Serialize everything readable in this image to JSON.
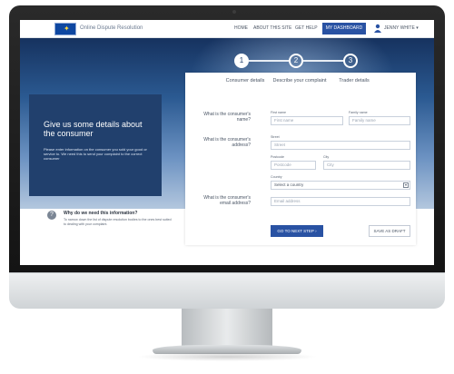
{
  "header": {
    "site_name": "Online Dispute Resolution",
    "nav": [
      "HOME",
      "ABOUT THIS SITE",
      "GET HELP"
    ],
    "dashboard_label": "MY DASHBOARD",
    "user_name": "JENNY WHITE ▾",
    "brand_color": "#2952a3"
  },
  "stepper": {
    "steps": [
      {
        "number": "1",
        "label": "Consumer details",
        "active": true
      },
      {
        "number": "2",
        "label": "Describe your complaint",
        "active": false
      },
      {
        "number": "3",
        "label": "Trader details",
        "active": false
      }
    ]
  },
  "intro": {
    "title": "Give us some details about the consumer",
    "text": "Please enter information on the consumer you sold your good or service to. We need this to send your complaint to the correct consumer"
  },
  "form": {
    "name_question": "What is the consumer's name?",
    "first_name_label": "First name",
    "first_name_placeholder": "First name",
    "family_name_label": "Family name",
    "family_name_placeholder": "Family name",
    "address_question": "What is the consumer's address?",
    "street_label": "Street",
    "street_placeholder": "Street",
    "postcode_label": "Postcode",
    "postcode_placeholder": "Postcode",
    "city_label": "City",
    "city_placeholder": "City",
    "country_label": "Country",
    "country_value": "Select a country",
    "email_question": "What is the consumer's email address?",
    "email_placeholder": "Email address",
    "next_button": "GO TO NEXT STEP ›",
    "draft_button": "SAVE AS DRAFT"
  },
  "help": {
    "title": "Why do we need this information?",
    "text": "To narrow down the list of dispute resolution bodies to the ones best suited to dealing with your complaint."
  }
}
